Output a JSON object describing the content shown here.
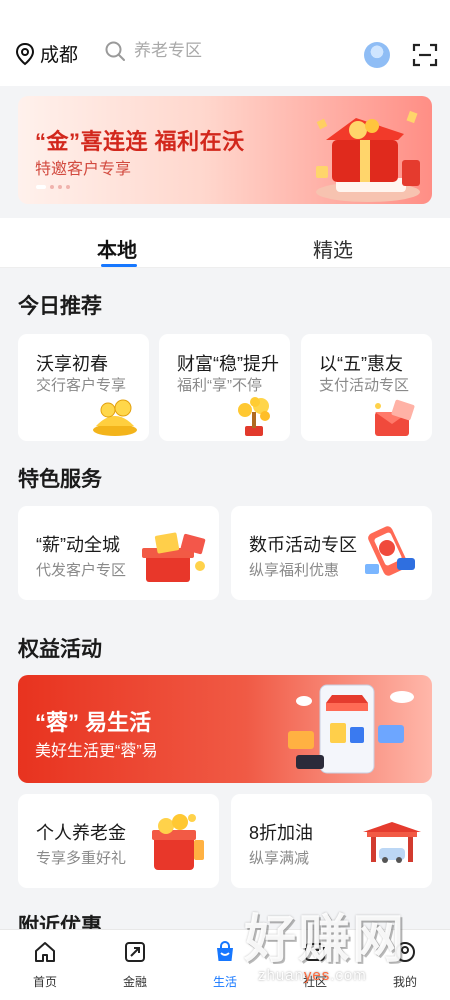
{
  "header": {
    "location": "成都",
    "search_placeholder": "养老专区"
  },
  "top_banner": {
    "title": "“金”喜连连 福利在沃",
    "subtitle": "特邀客户专享"
  },
  "tabs": [
    "本地",
    "精选"
  ],
  "today": {
    "title": "今日推荐",
    "cards": [
      {
        "title": "沃享初春",
        "subtitle": "交行客户专享"
      },
      {
        "title": "财富“稳”提升",
        "subtitle": "福利“享”不停"
      },
      {
        "title": "以“五”惠友",
        "subtitle": "支付活动专区"
      }
    ]
  },
  "special": {
    "title": "特色服务",
    "cards": [
      {
        "title": "“薪”动全城",
        "subtitle": "代发客户专区"
      },
      {
        "title": "数币活动专区",
        "subtitle": "纵享福利优惠"
      }
    ]
  },
  "benefits": {
    "title": "权益活动",
    "banner": {
      "title": "“蓉” 易生活",
      "subtitle": "美好生活更“蓉”易"
    },
    "cards": [
      {
        "title": "个人养老金",
        "subtitle": "专享多重好礼"
      },
      {
        "title": "8折加油",
        "subtitle": "纵享满减"
      }
    ]
  },
  "nearby": {
    "title": "附近优惠"
  },
  "bottom_nav": [
    {
      "label": "首页",
      "icon": "home-icon"
    },
    {
      "label": "金融",
      "icon": "finance-icon"
    },
    {
      "label": "生活",
      "icon": "life-icon"
    },
    {
      "label": "社区",
      "icon": "community-icon"
    },
    {
      "label": "我的",
      "icon": "profile-icon"
    }
  ],
  "watermark": {
    "big": "好赚网",
    "small_prefix": "zhuan",
    "small_accent": "yes",
    "small_suffix": ".com"
  },
  "colors": {
    "accent": "#1677ff",
    "brand_red": "#d2271c"
  }
}
